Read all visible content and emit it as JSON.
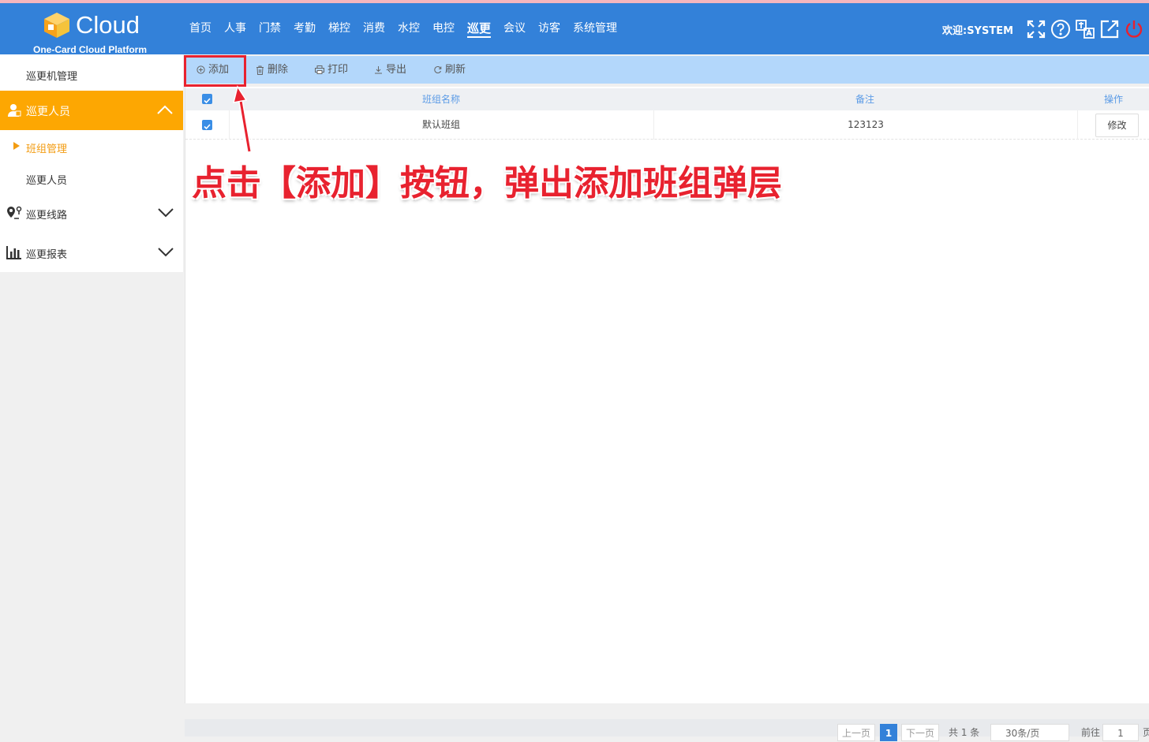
{
  "header": {
    "logo_text": "Cloud",
    "logo_sub": "One-Card Cloud Platform",
    "welcome": "欢迎:SYSTEM",
    "nav": [
      {
        "label": "首页"
      },
      {
        "label": "人事"
      },
      {
        "label": "门禁"
      },
      {
        "label": "考勤"
      },
      {
        "label": "梯控"
      },
      {
        "label": "消费"
      },
      {
        "label": "水控"
      },
      {
        "label": "电控"
      },
      {
        "label": "巡更",
        "active": true
      },
      {
        "label": "会议"
      },
      {
        "label": "访客"
      },
      {
        "label": "系统管理"
      }
    ],
    "icons": [
      "fullscreen-icon",
      "help-icon",
      "language-icon",
      "external-link-icon",
      "power-icon"
    ]
  },
  "sidebar": {
    "items": [
      {
        "label": "巡更机管理"
      },
      {
        "label": "巡更人员",
        "icon": "person-icon",
        "expanded": true
      },
      {
        "label": "班组管理",
        "active": true
      },
      {
        "label": "巡更人员"
      },
      {
        "label": "巡更线路",
        "icon": "route-icon"
      },
      {
        "label": "巡更报表",
        "icon": "report-icon"
      }
    ]
  },
  "toolbar": {
    "add": "添加",
    "delete": "删除",
    "print": "打印",
    "export": "导出",
    "refresh": "刷新"
  },
  "table": {
    "columns": [
      "班组名称",
      "备注",
      "操作"
    ],
    "rows": [
      {
        "name": "默认班组",
        "remark": "123123",
        "action": "修改",
        "checked": true
      }
    ]
  },
  "annotation": {
    "text": "点击【添加】按钮，弹出添加班组弹层",
    "color": "#e8222f"
  },
  "pagination": {
    "prev": "上一页",
    "current": "1",
    "next": "下一页",
    "total": "共 1 条",
    "page_size": "30条/页",
    "goto_label": "前往",
    "goto_value": "1",
    "page_suffix": "页"
  },
  "colors": {
    "header_bg": "#3381d9",
    "sidebar_active": "#fda702",
    "toolbar_bg": "#b3d7fb",
    "accent": "#3a8ee6"
  }
}
